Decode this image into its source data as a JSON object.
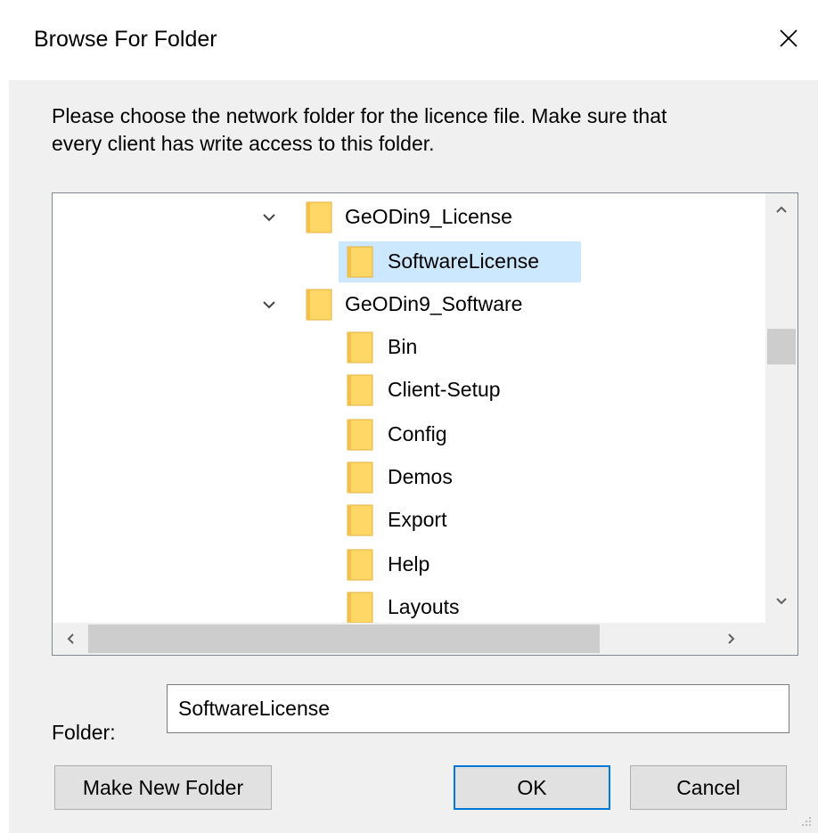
{
  "window": {
    "title": "Browse For Folder",
    "close_icon": "close-icon"
  },
  "prompt": {
    "line1": "Please choose the network folder for the licence file. Make sure that",
    "line2": "every client has write access to this folder."
  },
  "tree": {
    "selected_item": "SoftwareLicense",
    "items": [
      {
        "label": "GeODin9_License",
        "level": 0,
        "expanded": true,
        "icon": "folder-icon"
      },
      {
        "label": "SoftwareLicense",
        "level": 1,
        "expanded": false,
        "icon": "folder-icon"
      },
      {
        "label": "GeODin9_Software",
        "level": 0,
        "expanded": true,
        "icon": "folder-icon"
      },
      {
        "label": "Bin",
        "level": 1,
        "icon": "folder-icon"
      },
      {
        "label": "Client-Setup",
        "level": 1,
        "icon": "folder-icon"
      },
      {
        "label": "Config",
        "level": 1,
        "icon": "folder-icon"
      },
      {
        "label": "Demos",
        "level": 1,
        "icon": "folder-icon"
      },
      {
        "label": "Export",
        "level": 1,
        "icon": "folder-icon"
      },
      {
        "label": "Help",
        "level": 1,
        "icon": "folder-icon"
      },
      {
        "label": "Layouts",
        "level": 1,
        "icon": "folder-icon"
      }
    ]
  },
  "folder": {
    "label": "Folder:",
    "value": "SoftwareLicense"
  },
  "buttons": {
    "make_new_folder": "Make New Folder",
    "ok": "OK",
    "cancel": "Cancel"
  },
  "colors": {
    "selection": "#cce8ff",
    "folder_yellow": "#ffd766",
    "default_button_border": "#0078d7",
    "dialog_background": "#f0f0f0"
  }
}
